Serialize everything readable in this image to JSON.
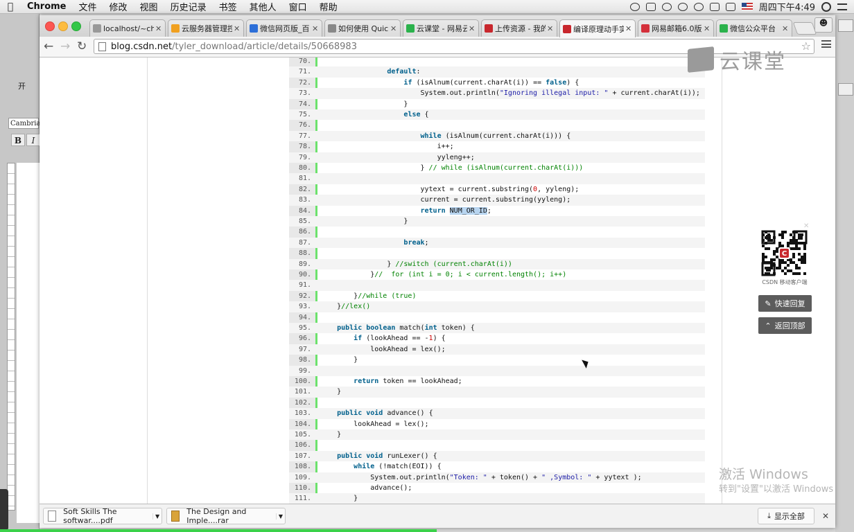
{
  "menubar": {
    "app": "Chrome",
    "items": [
      "文件",
      "修改",
      "视图",
      "历史记录",
      "书签",
      "其他人",
      "窗口",
      "帮助"
    ],
    "clock": "周四下午4:49"
  },
  "word": {
    "font": "Cambria",
    "bold": "B",
    "italic": "I",
    "home": "开"
  },
  "tabs": [
    {
      "label": "localhost/~che",
      "color": "#999999"
    },
    {
      "label": "云服务器管理控",
      "color": "#f0a020"
    },
    {
      "label": "微信网页版_百",
      "color": "#2d6fd8"
    },
    {
      "label": "如何使用 Quick",
      "color": "#888888"
    },
    {
      "label": "云课堂 - 网易云",
      "color": "#2bb24c"
    },
    {
      "label": "上传资源 - 我的",
      "color": "#c8272d"
    },
    {
      "label": "编译原理动手实",
      "color": "#c8272d"
    },
    {
      "label": "网易邮箱6.0版",
      "color": "#d4303b"
    },
    {
      "label": "微信公众平台",
      "color": "#2bb24c"
    }
  ],
  "address": {
    "domain": "blog.csdn.net",
    "path": "/tyler_download/article/details/50668983"
  },
  "code_lines": [
    {
      "n": "70.",
      "h": ""
    },
    {
      "n": "71.",
      "h": "                <span class='kw'>default</span>:"
    },
    {
      "n": "72.",
      "h": "                    <span class='kw'>if</span> (isAlnum(current.charAt(i)) == <span class='kw'>false</span>) {"
    },
    {
      "n": "73.",
      "h": "                        System.out.println(<span class='str'>\"Ignoring illegal input: \"</span> + current.charAt(i));"
    },
    {
      "n": "74.",
      "h": "                    }"
    },
    {
      "n": "75.",
      "h": "                    <span class='kw'>else</span> {"
    },
    {
      "n": "76.",
      "h": ""
    },
    {
      "n": "77.",
      "h": "                        <span class='kw'>while</span> (isAlnum(current.charAt(i))) {"
    },
    {
      "n": "78.",
      "h": "                            i++;"
    },
    {
      "n": "79.",
      "h": "                            yyleng++;"
    },
    {
      "n": "80.",
      "h": "                        } <span class='cm'>// while (isAlnum(current.charAt(i)))</span>"
    },
    {
      "n": "81.",
      "h": ""
    },
    {
      "n": "82.",
      "h": "                        yytext = current.substring(<span class='num'>0</span>, yyleng);"
    },
    {
      "n": "83.",
      "h": "                        current = current.substring(yyleng);"
    },
    {
      "n": "84.",
      "h": "                        <span class='kw'>return</span> <span class='hl'>NUM_OR_ID</span>;"
    },
    {
      "n": "85.",
      "h": "                    }"
    },
    {
      "n": "86.",
      "h": ""
    },
    {
      "n": "87.",
      "h": "                    <span class='kw'>break</span>;"
    },
    {
      "n": "88.",
      "h": ""
    },
    {
      "n": "89.",
      "h": "                } <span class='cm'>//switch (current.charAt(i))</span>"
    },
    {
      "n": "90.",
      "h": "            }<span class='cm'>//  for (int i = 0; i &lt; current.length(); i++)</span>"
    },
    {
      "n": "91.",
      "h": ""
    },
    {
      "n": "92.",
      "h": "        }<span class='cm'>//while (true)</span>"
    },
    {
      "n": "93.",
      "h": "    }<span class='cm'>//lex()</span>"
    },
    {
      "n": "94.",
      "h": ""
    },
    {
      "n": "95.",
      "h": "    <span class='kw'>public</span> <span class='kw'>boolean</span> match(<span class='kw'>int</span> token) {"
    },
    {
      "n": "96.",
      "h": "        <span class='kw'>if</span> (lookAhead == -<span class='num'>1</span>) {"
    },
    {
      "n": "97.",
      "h": "            lookAhead = lex();"
    },
    {
      "n": "98.",
      "h": "        }"
    },
    {
      "n": "99.",
      "h": ""
    },
    {
      "n": "100.",
      "h": "        <span class='kw'>return</span> token == lookAhead;"
    },
    {
      "n": "101.",
      "h": "    }"
    },
    {
      "n": "102.",
      "h": ""
    },
    {
      "n": "103.",
      "h": "    <span class='kw'>public</span> <span class='kw'>void</span> advance() {"
    },
    {
      "n": "104.",
      "h": "        lookAhead = lex();"
    },
    {
      "n": "105.",
      "h": "    }"
    },
    {
      "n": "106.",
      "h": ""
    },
    {
      "n": "107.",
      "h": "    <span class='kw'>public</span> <span class='kw'>void</span> runLexer() {"
    },
    {
      "n": "108.",
      "h": "        <span class='kw'>while</span> (!match(EOI)) {"
    },
    {
      "n": "109.",
      "h": "            System.out.println(<span class='str'>\"Token: \"</span> + token() + <span class='str'>\" ,Symbol: \"</span> + yytext );"
    },
    {
      "n": "110.",
      "h": "            advance();"
    },
    {
      "n": "111.",
      "h": "        }"
    }
  ],
  "brand": "云课堂",
  "qr_caption": "CSDN 移动客户端",
  "side_buttons": {
    "quick_reply": "快速回复",
    "back_top": "返回顶部"
  },
  "watermark": {
    "title": "激活 Windows",
    "subtitle": "转到\"设置\"以激活 Windows。"
  },
  "downloads": [
    {
      "name": "Soft Skills The softwar....pdf",
      "type": "pdf"
    },
    {
      "name": "The Design and Imple....rar",
      "type": "rar"
    }
  ],
  "show_all": "显示全部",
  "colors": {
    "gutter_green": "#6ce26c",
    "keyword": "#00608c",
    "string": "#1a1aa6",
    "comment": "#008200"
  }
}
